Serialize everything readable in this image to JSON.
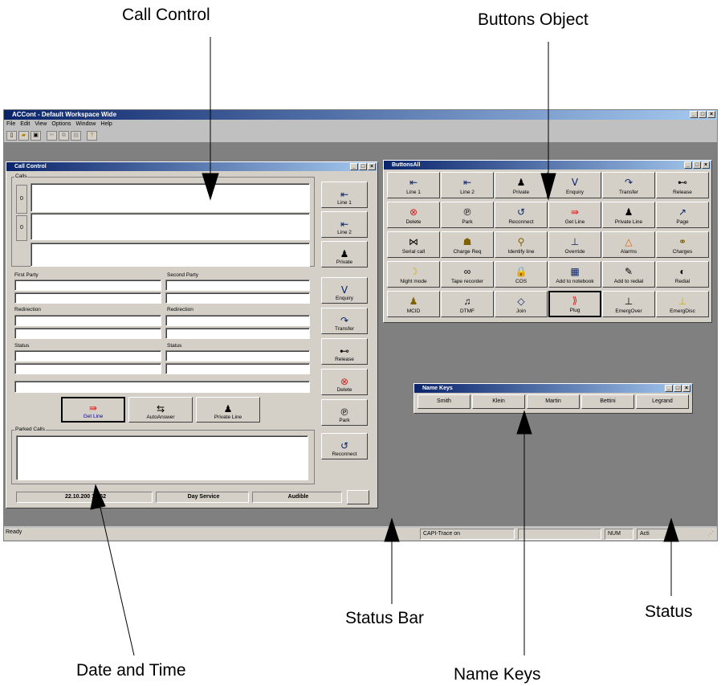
{
  "annotations": {
    "call_control": "Call Control",
    "buttons_object": "Buttons Object",
    "status_bar": "Status Bar",
    "status": "Status",
    "date_and_time": "Date and Time",
    "name_keys": "Name Keys"
  },
  "app": {
    "title": "ACCont - Default Workspace Wide",
    "menu": [
      "File",
      "Edit",
      "View",
      "Options",
      "Window",
      "Help"
    ],
    "toolbar_icons": [
      "new-icon",
      "open-icon",
      "save-icon",
      "cut-icon",
      "copy-icon",
      "paste-icon",
      "help-icon"
    ]
  },
  "call_control": {
    "title": "Call Control",
    "calls_label": "Calls",
    "call_numbers": [
      "0",
      "0"
    ],
    "first_party_label": "First Party",
    "second_party_label": "Second Party",
    "redirection_label_1": "Redirection",
    "redirection_label_2": "Redirection",
    "status_label_1": "Status",
    "status_label_2": "Status",
    "get_line": "Get Line",
    "auto_answer": "AutoAnswer",
    "private_line": "Private Line",
    "parked_calls_label": "Parked Calls",
    "datetime": "22.10.200 16:52",
    "day_service": "Day Service",
    "audible": "Audible",
    "side_buttons": [
      {
        "label": "Line 1",
        "icon": "line1-icon"
      },
      {
        "label": "Line 2",
        "icon": "line2-icon"
      },
      {
        "label": "Private",
        "icon": "private-icon"
      },
      {
        "label": "Enquiry",
        "icon": "enquiry-icon"
      },
      {
        "label": "Transfer",
        "icon": "transfer-icon"
      },
      {
        "label": "Release",
        "icon": "release-icon"
      },
      {
        "label": "Delete",
        "icon": "delete-icon"
      },
      {
        "label": "Park",
        "icon": "park-icon"
      },
      {
        "label": "Reconnect",
        "icon": "reconnect-icon"
      }
    ]
  },
  "buttons_all": {
    "title": "ButtonsAll",
    "buttons": [
      "Line 1",
      "Line 2",
      "Private",
      "Enquiry",
      "Transfer",
      "Release",
      "Delete",
      "Park",
      "Reconnect",
      "Get Line",
      "Private Line",
      "Page",
      "Serial call",
      "Charge Req",
      "Identify line",
      "Override",
      "Alarms",
      "Charges",
      "Night mode",
      "Tape recorder",
      "COS",
      "Add to notebook",
      "Add to redial",
      "Redial",
      "MCID",
      "DTMF",
      "Join",
      "Plug",
      "EmergOver",
      "EmergDisc"
    ]
  },
  "name_keys": {
    "title": "Name Keys",
    "keys": [
      "Smith",
      "Klein",
      "Martin",
      "Bettini",
      "Legrand"
    ]
  },
  "status_bar": {
    "ready": "Ready",
    "capi": "CAPI-Trace on",
    "num": "NUM",
    "act": "Acti"
  }
}
